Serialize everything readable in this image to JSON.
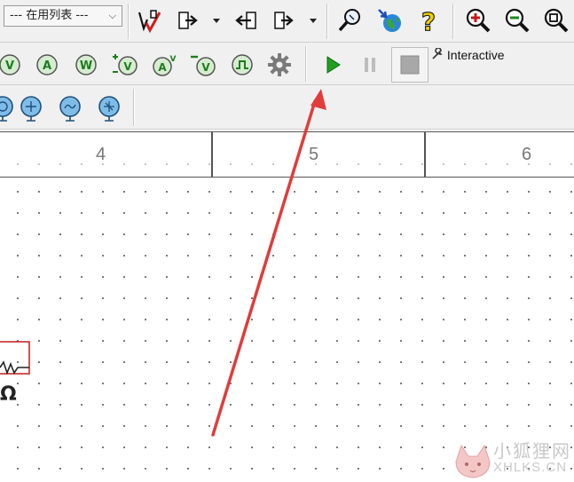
{
  "toolbar_top": {
    "combo_value": "--- 在用列表 ---",
    "combo_arrow": "⌵"
  },
  "toolbar_sim": {
    "interactive_label": "Interactive",
    "interactive_icon": "wrench-icon",
    "run_color": "#1fa01f"
  },
  "probes": {
    "labels": [
      "V",
      "A",
      "W",
      "V",
      "A",
      "V",
      "ЛЛ"
    ]
  },
  "ruler": {
    "numbers": [
      "4",
      "5",
      "6"
    ]
  },
  "component": {
    "unit": "Ω",
    "outline_color": "#c41a1a"
  },
  "annotation": {
    "arrow_color": "#e03c3c"
  },
  "watermark": {
    "line1": "小狐狸网",
    "line2": "XHLKS.CN"
  }
}
